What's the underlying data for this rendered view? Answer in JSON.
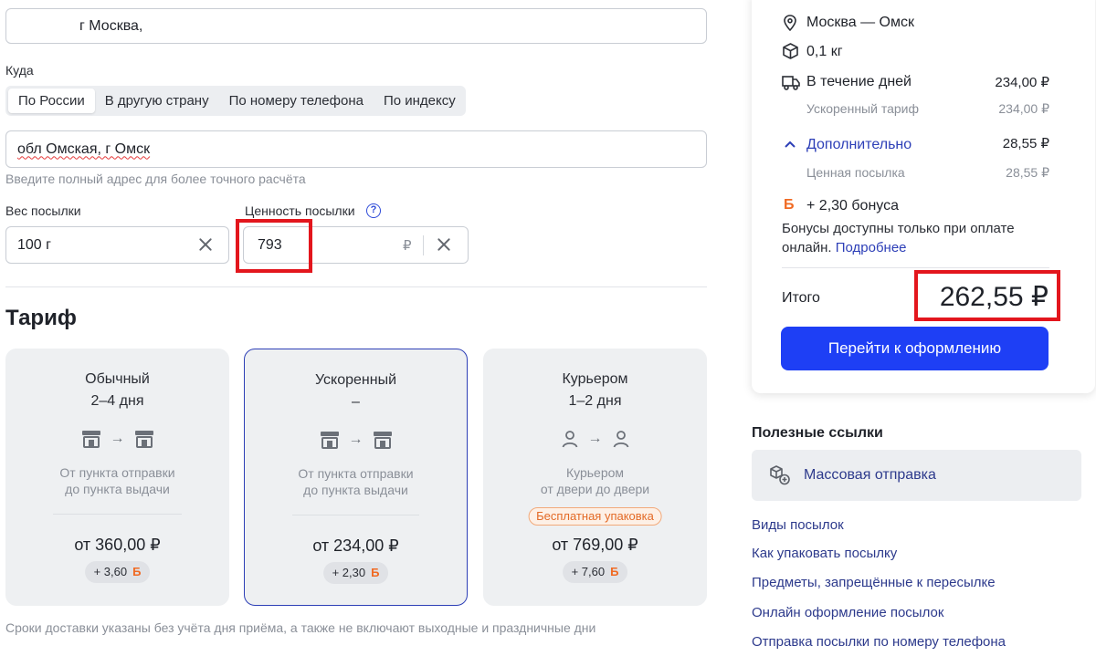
{
  "from": {
    "value": "г Москва,"
  },
  "to": {
    "label": "Куда",
    "tabs": [
      "По России",
      "В другую страну",
      "По номеру телефона",
      "По индексу"
    ],
    "active_tab": "По России",
    "value": "обл Омская, г Омск",
    "hint": "Введите полный адрес для более точного расчёта"
  },
  "weight": {
    "label": "Вес посылки",
    "value": "100 г"
  },
  "declared_value": {
    "label": "Ценность посылки",
    "value": "793",
    "currency": "₽",
    "help": "?"
  },
  "tariff": {
    "heading": "Тариф",
    "cards": [
      {
        "name": "Обычный",
        "days": "2–4 дня",
        "desc1": "От пункта отправки",
        "desc2": "до пункта выдачи",
        "price": "от 360,00 ₽",
        "bonus": "+ 3,60",
        "selected": false
      },
      {
        "name": "Ускоренный",
        "days": "–",
        "desc1": "От пункта отправки",
        "desc2": "до пункта выдачи",
        "price": "от 234,00 ₽",
        "bonus": "+ 2,30",
        "selected": true
      },
      {
        "name": "Курьером",
        "days": "1–2 дня",
        "desc1": "Курьером",
        "desc2": "от двери до двери",
        "badge": "Бесплатная упаковка",
        "price": "от 769,00 ₽",
        "bonus": "+ 7,60",
        "selected": false
      }
    ],
    "bonus_symbol": "Б",
    "note": "Сроки доставки указаны без учёта дня приёма, а также не включают выходные и праздничные дни"
  },
  "summary": {
    "route": "Москва — Омск",
    "weight": "0,1 кг",
    "delivery_label": "В течение дней",
    "delivery_value": "234,00 ₽",
    "tariff_label": "Ускоренный тариф",
    "tariff_value": "234,00 ₽",
    "extra_label": "Дополнительно",
    "extra_value": "28,55 ₽",
    "valued_label": "Ценная посылка",
    "valued_value": "28,55 ₽",
    "bonus_text": "+ 2,30 бонуса",
    "bonus_note1": "Бонусы доступны только при оплате",
    "bonus_note2_prefix": "онлайн.",
    "bonus_more": "Подробнее",
    "total_label": "Итого",
    "total_value": "262,55 ₽",
    "checkout_label": "Перейти к оформлению"
  },
  "useful": {
    "heading": "Полезные ссылки",
    "mass_label": "Массовая отправка",
    "links": [
      "Виды посылок",
      "Как упаковать посылку",
      "Предметы, запрещённые к пересылке",
      "Онлайн оформление посылок",
      "Отправка посылки по номеру телефона"
    ]
  },
  "colors": {
    "accent": "#1e3ff5",
    "highlight": "#e3161d",
    "bonus": "#f06a23",
    "link": "#2d3a8c"
  }
}
